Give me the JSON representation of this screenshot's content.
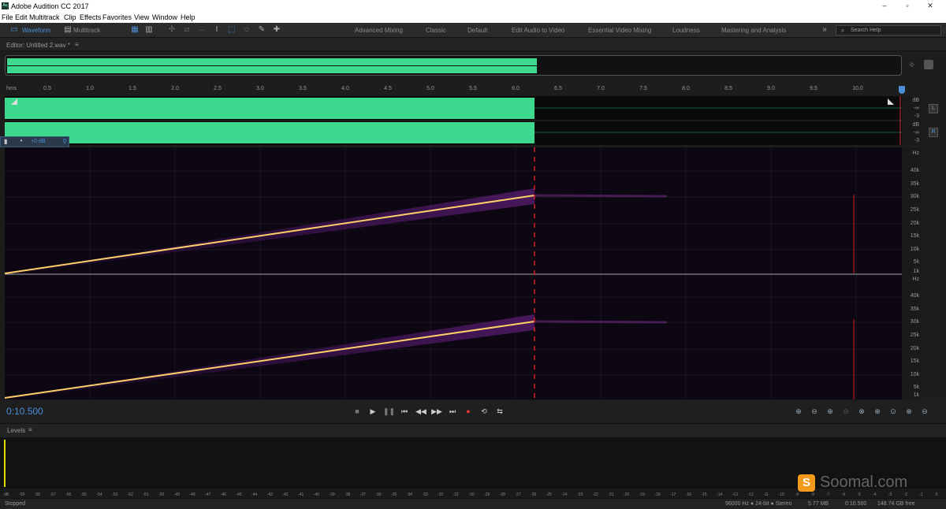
{
  "window": {
    "app_title": "Adobe Audition CC 2017",
    "app_icon": "Au"
  },
  "menu": [
    "File",
    "Edit",
    "Multitrack",
    "Clip",
    "Effects",
    "Favorites",
    "View",
    "Window",
    "Help"
  ],
  "toolbar": {
    "waveform_label": "Waveform",
    "multitrack_label": "Multitrack",
    "workspaces": [
      "Advanced Mixing",
      "Classic",
      "Default",
      "Edit Audio to Video",
      "Essential Video Mixing",
      "Loudness",
      "Mastering and Analysis"
    ],
    "search_placeholder": "Search Help",
    "accent": "#4a8fd8"
  },
  "editor": {
    "tab_label": "Editor: Untitled 2.wav *"
  },
  "ruler": {
    "unit": "hms",
    "ticks": [
      "0.5",
      "1.0",
      "1.5",
      "2.0",
      "2.5",
      "3.0",
      "3.5",
      "4.0",
      "4.5",
      "5.0",
      "5.5",
      "6.0",
      "6.5",
      "7.0",
      "7.5",
      "8.0",
      "8.5",
      "9.0",
      "9.5",
      "10.0"
    ]
  },
  "waveform": {
    "color": "#3dd98e",
    "db_label": "dB",
    "inf_label": "-∞",
    "minus3_label": "-3",
    "left_channel": "L",
    "right_channel": "R",
    "gain_value": "+0 dB"
  },
  "spectral": {
    "hz_label": "Hz",
    "freq_ticks": [
      "40k",
      "35k",
      "30k",
      "25k",
      "20k",
      "15k",
      "10k",
      "5k",
      "1k"
    ]
  },
  "transport": {
    "current_time": "0:10.500"
  },
  "levels": {
    "panel_title": "Levels",
    "scale": [
      "dB",
      "-59",
      "-58",
      "-57",
      "-56",
      "-55",
      "-54",
      "-53",
      "-52",
      "-51",
      "-50",
      "-49",
      "-48",
      "-47",
      "-46",
      "-45",
      "-44",
      "-43",
      "-42",
      "-41",
      "-40",
      "-39",
      "-38",
      "-37",
      "-36",
      "-35",
      "-34",
      "-33",
      "-32",
      "-31",
      "-30",
      "-29",
      "-28",
      "-27",
      "-26",
      "-25",
      "-24",
      "-23",
      "-22",
      "-21",
      "-20",
      "-19",
      "-18",
      "-17",
      "-16",
      "-15",
      "-14",
      "-13",
      "-12",
      "-11",
      "-10",
      "-9",
      "-8",
      "-7",
      "-6",
      "-5",
      "-4",
      "-3",
      "-2",
      "-1",
      "0"
    ]
  },
  "status": {
    "state": "Stopped",
    "format": "96000 Hz ● 24-bit ● Stereo",
    "file_size": "5.77 MB",
    "duration": "0:10.500",
    "free_space": "148.74 GB free"
  },
  "watermark": {
    "text": "Soomal.com"
  }
}
